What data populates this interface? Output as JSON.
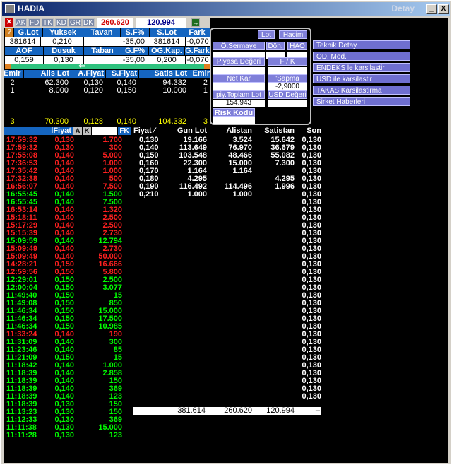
{
  "window": {
    "title": "HADIA",
    "right_title": "Detay",
    "min": "_",
    "max": "□",
    "close": "X"
  },
  "toolbar": {
    "tabs": [
      "AK",
      "FD",
      "TK",
      "KD",
      "GR",
      "DK"
    ],
    "price_red": "260.620",
    "price_blue": "120.994",
    "go_arrow": "→"
  },
  "summary": {
    "headers1": [
      "G.Lot",
      "Yuksek",
      "Tavan",
      "S.F%",
      "S.Lot",
      "Fark"
    ],
    "values1": [
      "381614",
      "0,210",
      "-35,00",
      "381614",
      "-0,070"
    ],
    "headers2": [
      "AOF",
      "Dusuk",
      "Taban",
      "G.F%",
      "OG.Kap.",
      "G.Fark"
    ],
    "values2": [
      "0,159",
      "0,130",
      "-35,00",
      "0,200",
      "-0,070"
    ]
  },
  "depth": {
    "headers": [
      "Emir",
      "Alis Lot",
      "A.Fiyat",
      "S.Fiyat",
      "Satis Lot",
      "Emir"
    ],
    "rows": [
      [
        "2",
        "62.300",
        "0,130",
        "0,140",
        "94.332",
        "2"
      ],
      [
        "1",
        "8.000",
        "0,120",
        "0,150",
        "10.000",
        "1"
      ]
    ],
    "totals": [
      "3",
      "70.300",
      "0,128",
      "0,140",
      "104.332",
      "3"
    ]
  },
  "panel": {
    "lot": "Lot",
    "hacim": "Hacim",
    "osermaye": "Ö.Sermaye",
    "don": "Dön.",
    "hao": "HAO",
    "piyasa": "Piyasa Değeri",
    "fk": "F / K",
    "netkar": "Net Kar",
    "sapma": "'Sapma",
    "sapma_val": "-2,9000",
    "piy_toplam": "piy.Toplam Lot",
    "usd": "USD Değeri",
    "piy_toplam_val": "154.943",
    "risk": "Risk Kodu"
  },
  "menu": [
    "Teknik Detay",
    "OD. Mod.",
    "ENDEKS le karsilastir",
    "USD ile karsilastir",
    "TAKAS Karsilastirma",
    "Sirket Haberleri"
  ],
  "trades_header": {
    "fiyat": "lFiyat",
    "a": "A",
    "k": "K",
    "fk": "FK"
  },
  "trades": [
    [
      "17:59:32",
      "0,130",
      "1.700",
      "r"
    ],
    [
      "17:59:32",
      "0,130",
      "300",
      "r"
    ],
    [
      "17:55:08",
      "0,140",
      "5.000",
      "r"
    ],
    [
      "17:36:53",
      "0,140",
      "1.000",
      "r"
    ],
    [
      "17:35:42",
      "0,140",
      "1.000",
      "r"
    ],
    [
      "17:32:38",
      "0,140",
      "500",
      "r"
    ],
    [
      "16:56:07",
      "0,140",
      "7.500",
      "r"
    ],
    [
      "16:55:45",
      "0,140",
      "1.500",
      "g"
    ],
    [
      "16:55:45",
      "0,140",
      "7.500",
      "g"
    ],
    [
      "16:53:14",
      "0,140",
      "1.320",
      "r"
    ],
    [
      "15:18:11",
      "0,140",
      "2.500",
      "r"
    ],
    [
      "15:17:29",
      "0,140",
      "2.500",
      "r"
    ],
    [
      "15:15:39",
      "0,140",
      "2.730",
      "r"
    ],
    [
      "15:09:59",
      "0,140",
      "12.794",
      "g"
    ],
    [
      "15:09:49",
      "0,140",
      "2.730",
      "r"
    ],
    [
      "15:09:49",
      "0,140",
      "50.000",
      "r"
    ],
    [
      "14:28:21",
      "0,150",
      "16.666",
      "r"
    ],
    [
      "12:59:56",
      "0,150",
      "5.800",
      "r"
    ],
    [
      "12:29:01",
      "0,150",
      "2.500",
      "g"
    ],
    [
      "12:00:04",
      "0,150",
      "3.077",
      "g"
    ],
    [
      "11:49:40",
      "0,150",
      "15",
      "g"
    ],
    [
      "11:49:08",
      "0,150",
      "850",
      "g"
    ],
    [
      "11:46:34",
      "0,150",
      "15.000",
      "g"
    ],
    [
      "11:46:34",
      "0,150",
      "17.500",
      "g"
    ],
    [
      "11:46:34",
      "0,150",
      "10.985",
      "g"
    ],
    [
      "11:33:24",
      "0,140",
      "190",
      "r"
    ],
    [
      "11:31:09",
      "0,140",
      "300",
      "g"
    ],
    [
      "11:23:46",
      "0,140",
      "85",
      "g"
    ],
    [
      "11:21:09",
      "0,150",
      "15",
      "g"
    ],
    [
      "11:18:42",
      "0,140",
      "1.000",
      "g"
    ],
    [
      "11:18:39",
      "0,140",
      "2.858",
      "g"
    ],
    [
      "11:18:39",
      "0,140",
      "150",
      "g"
    ],
    [
      "11:18:39",
      "0,140",
      "369",
      "g"
    ],
    [
      "11:18:39",
      "0,140",
      "123",
      "g"
    ],
    [
      "11:18:39",
      "0,130",
      "150",
      "g"
    ],
    [
      "11:13:23",
      "0,130",
      "150",
      "g"
    ],
    [
      "11:12:33",
      "0,130",
      "369",
      "g"
    ],
    [
      "11:11:38",
      "0,130",
      "15.000",
      "g"
    ],
    [
      "11:11:28",
      "0,130",
      "123",
      "g"
    ]
  ],
  "levels_header": {
    "fiyat": "Fiyat ⁄",
    "gunlot": "Gun Lot",
    "alistan": "Alistan",
    "satistan": "Satistan",
    "son": "Son"
  },
  "levels": [
    [
      "0,130",
      "19.166",
      "3.524",
      "15.642"
    ],
    [
      "0,140",
      "113.649",
      "76.970",
      "36.679"
    ],
    [
      "0,150",
      "103.548",
      "48.466",
      "55.082"
    ],
    [
      "0,160",
      "22.300",
      "15.000",
      "7.300"
    ],
    [
      "0,170",
      "1.164",
      "1.164",
      ""
    ],
    [
      "0,180",
      "4.295",
      "",
      "4.295"
    ],
    [
      "0,190",
      "116.492",
      "114.496",
      "1.996"
    ],
    [
      "0,210",
      "1.000",
      "1.000",
      ""
    ]
  ],
  "son_value": "0,130",
  "levels_total": [
    "381.614",
    "260.620",
    "120.994",
    "–"
  ]
}
